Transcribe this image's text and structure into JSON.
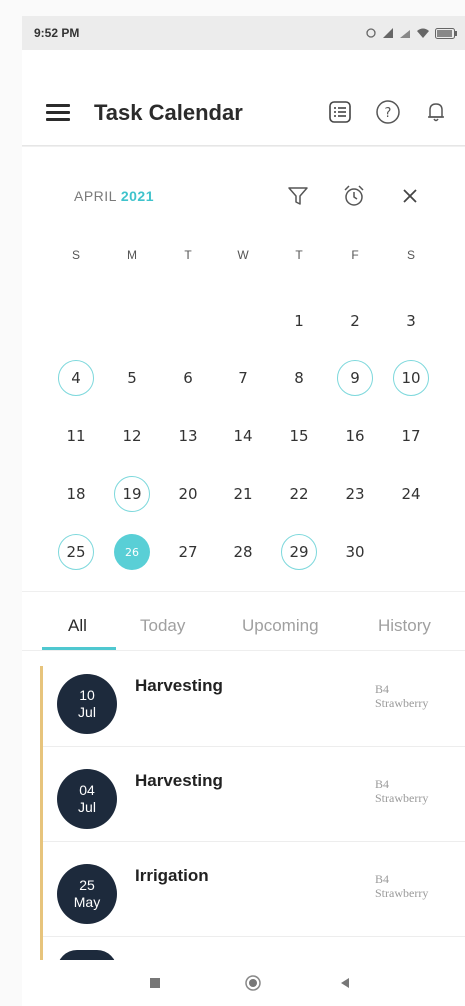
{
  "status_bar": {
    "time": "9:52 PM",
    "icons": [
      "alarm-icon",
      "signal-icon",
      "signal-icon",
      "wifi-icon",
      "battery-icon"
    ]
  },
  "app_bar": {
    "title": "Task Calendar",
    "icons": [
      "menu-icon",
      "list-icon",
      "help-icon",
      "bell-icon"
    ]
  },
  "calendar": {
    "month": "APRIL",
    "year": "2021",
    "weekdays": [
      "S",
      "M",
      "T",
      "W",
      "T",
      "F",
      "S"
    ],
    "weeks": [
      [
        "",
        "",
        "",
        "",
        "1",
        "2",
        "3"
      ],
      [
        "4",
        "5",
        "6",
        "7",
        "8",
        "9",
        "10"
      ],
      [
        "11",
        "12",
        "13",
        "14",
        "15",
        "16",
        "17"
      ],
      [
        "18",
        "19",
        "20",
        "21",
        "22",
        "23",
        "24"
      ],
      [
        "25",
        "26",
        "27",
        "28",
        "29",
        "30",
        ""
      ]
    ],
    "marked_days": [
      "4",
      "9",
      "10",
      "19",
      "25",
      "29"
    ],
    "selected_day": "26",
    "accent_color": "#59cfd6"
  },
  "tabs": [
    "All",
    "Today",
    "Upcoming",
    "History"
  ],
  "active_tab": "All",
  "tasks": [
    {
      "day": "10",
      "month": "Jul",
      "title": "Harvesting",
      "block": "B4",
      "crop": "Strawberry"
    },
    {
      "day": "04",
      "month": "Jul",
      "title": "Harvesting",
      "block": "B4",
      "crop": "Strawberry"
    },
    {
      "day": "25",
      "month": "May",
      "title": "Irrigation",
      "block": "B4",
      "crop": "Strawberry"
    }
  ],
  "nav": [
    "recents-icon",
    "home-icon",
    "back-icon"
  ]
}
